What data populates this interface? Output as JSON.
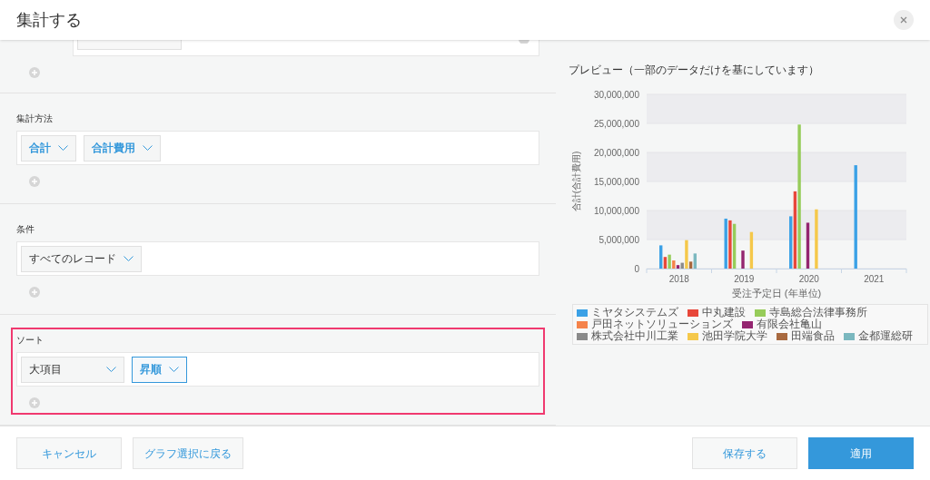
{
  "dialog": {
    "title": "集計する"
  },
  "sections": [
    {
      "kind": "cut_off"
    },
    {
      "kind": "settings",
      "label": "集計方法",
      "highlighted": false,
      "selects": [
        {
          "value": "合計",
          "kind": "link",
          "focused": false
        },
        {
          "value": "合計費用",
          "kind": "link",
          "focused": false
        }
      ]
    },
    {
      "kind": "settings",
      "label": "条件",
      "highlighted": false,
      "selects": [
        {
          "value": "すべてのレコード",
          "kind": "plain",
          "focused": false
        }
      ]
    },
    {
      "kind": "settings",
      "label": "ソート",
      "highlighted": true,
      "selects": [
        {
          "value": "大項目",
          "kind": "plain",
          "focused": false
        },
        {
          "value": "昇順",
          "kind": "link",
          "focused": true
        }
      ]
    }
  ],
  "preview": {
    "title": "プレビュー（一部のデータだけを基にしています）",
    "chart_data": {
      "type": "bar",
      "xlabel": "受注予定日 (年単位)",
      "ylabel": "合計(合計費用)",
      "categories": [
        "2018",
        "2019",
        "2020",
        "2021"
      ],
      "ylim": [
        0,
        30000000
      ],
      "grid": true,
      "legend": true,
      "yticks": [
        {
          "value": 0,
          "label": "0"
        },
        {
          "value": 5000000,
          "label": "5,000,000"
        },
        {
          "value": 10000000,
          "label": "10,000,000"
        },
        {
          "value": 15000000,
          "label": "15,000,000"
        },
        {
          "value": 20000000,
          "label": "20,000,000"
        },
        {
          "value": 25000000,
          "label": "25,000,000"
        },
        {
          "value": 30000000,
          "label": "30,000,000"
        }
      ],
      "series": [
        {
          "name": "ミヤタシステムズ",
          "color": "#3ba1e6",
          "values": [
            4000000,
            8600000,
            9000000,
            17800000
          ]
        },
        {
          "name": "中丸建設",
          "color": "#e8473a",
          "values": [
            2000000,
            8300000,
            13300000,
            null
          ]
        },
        {
          "name": "寺島総合法律事務所",
          "color": "#97cc5a",
          "values": [
            2400000,
            7700000,
            24800000,
            null
          ]
        },
        {
          "name": "戸田ネットソリューションズ",
          "color": "#f5834a",
          "values": [
            1400000,
            null,
            null,
            null
          ]
        },
        {
          "name": "有限会社亀山",
          "color": "#942570",
          "values": [
            600000,
            3100000,
            7900000,
            null
          ]
        },
        {
          "name": "株式会社中川工業",
          "color": "#8a8a8a",
          "values": [
            1000000,
            null,
            null,
            null
          ]
        },
        {
          "name": "池田学院大学",
          "color": "#f5c84a",
          "values": [
            4900000,
            6300000,
            10200000,
            null
          ]
        },
        {
          "name": "田端食品",
          "color": "#a8693f",
          "values": [
            1200000,
            null,
            null,
            null
          ]
        },
        {
          "name": "金都運総研",
          "color": "#7bb8bf",
          "values": [
            2600000,
            null,
            null,
            null
          ]
        }
      ]
    }
  },
  "footer": {
    "left_buttons": [
      {
        "label": "キャンセル",
        "primary": false
      },
      {
        "label": "グラフ選択に戻る",
        "primary": false
      }
    ],
    "right_buttons": [
      {
        "label": "保存する",
        "primary": false
      },
      {
        "label": "適用",
        "primary": true
      }
    ]
  }
}
